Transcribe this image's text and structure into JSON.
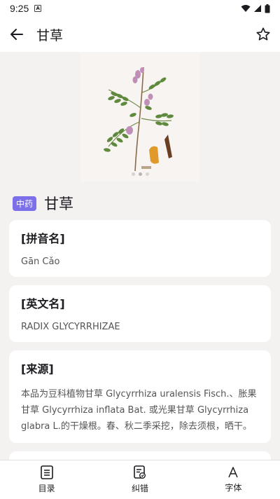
{
  "status_bar": {
    "time": "9:25"
  },
  "app_bar": {
    "title": "甘草"
  },
  "hero": {
    "slide_count": 3,
    "active_slide": 1
  },
  "header": {
    "badge": "中药",
    "title": "甘草"
  },
  "sections": {
    "pinyin": {
      "heading": "[拼音名]",
      "text": "Gān Cǎo"
    },
    "english": {
      "heading": "[英文名]",
      "text": "RADIX GLYCYRRHIZAE"
    },
    "source": {
      "heading": "[来源]",
      "text": "本品为豆科植物甘草 Glycyrrhiza uralensis Fisch.、胀果甘草 Glycyrrhiza inflata Bat. 或光果甘草 Glycyrrhiza glabra L.的干燥根。春、秋二季采挖，除去须根，晒干。"
    }
  },
  "bottom_nav": {
    "items": [
      {
        "label": "目录",
        "icon": "list-icon"
      },
      {
        "label": "纠错",
        "icon": "edit-document-icon"
      },
      {
        "label": "字体",
        "icon": "font-icon"
      }
    ]
  }
}
